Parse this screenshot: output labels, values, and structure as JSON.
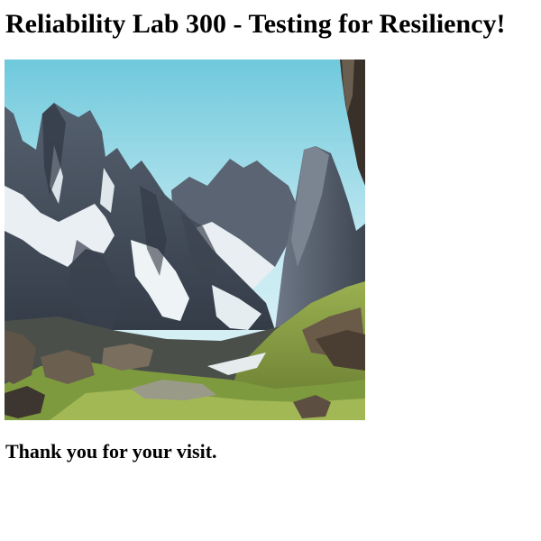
{
  "page": {
    "title": "Reliability Lab 300 - Testing for Resiliency!",
    "thanks_message": "Thank you for your visit."
  },
  "image": {
    "subject": "mountain-landscape",
    "colors": {
      "sky_top": "#7fd0e0",
      "sky_bottom": "#d8f0f4",
      "rock_dark": "#3c4654",
      "rock_mid": "#6a7482",
      "snow": "#eef3f6",
      "grass": "#8aa04a",
      "grass_dark": "#4e5e2a",
      "boulder": "#8a7c6a"
    }
  }
}
